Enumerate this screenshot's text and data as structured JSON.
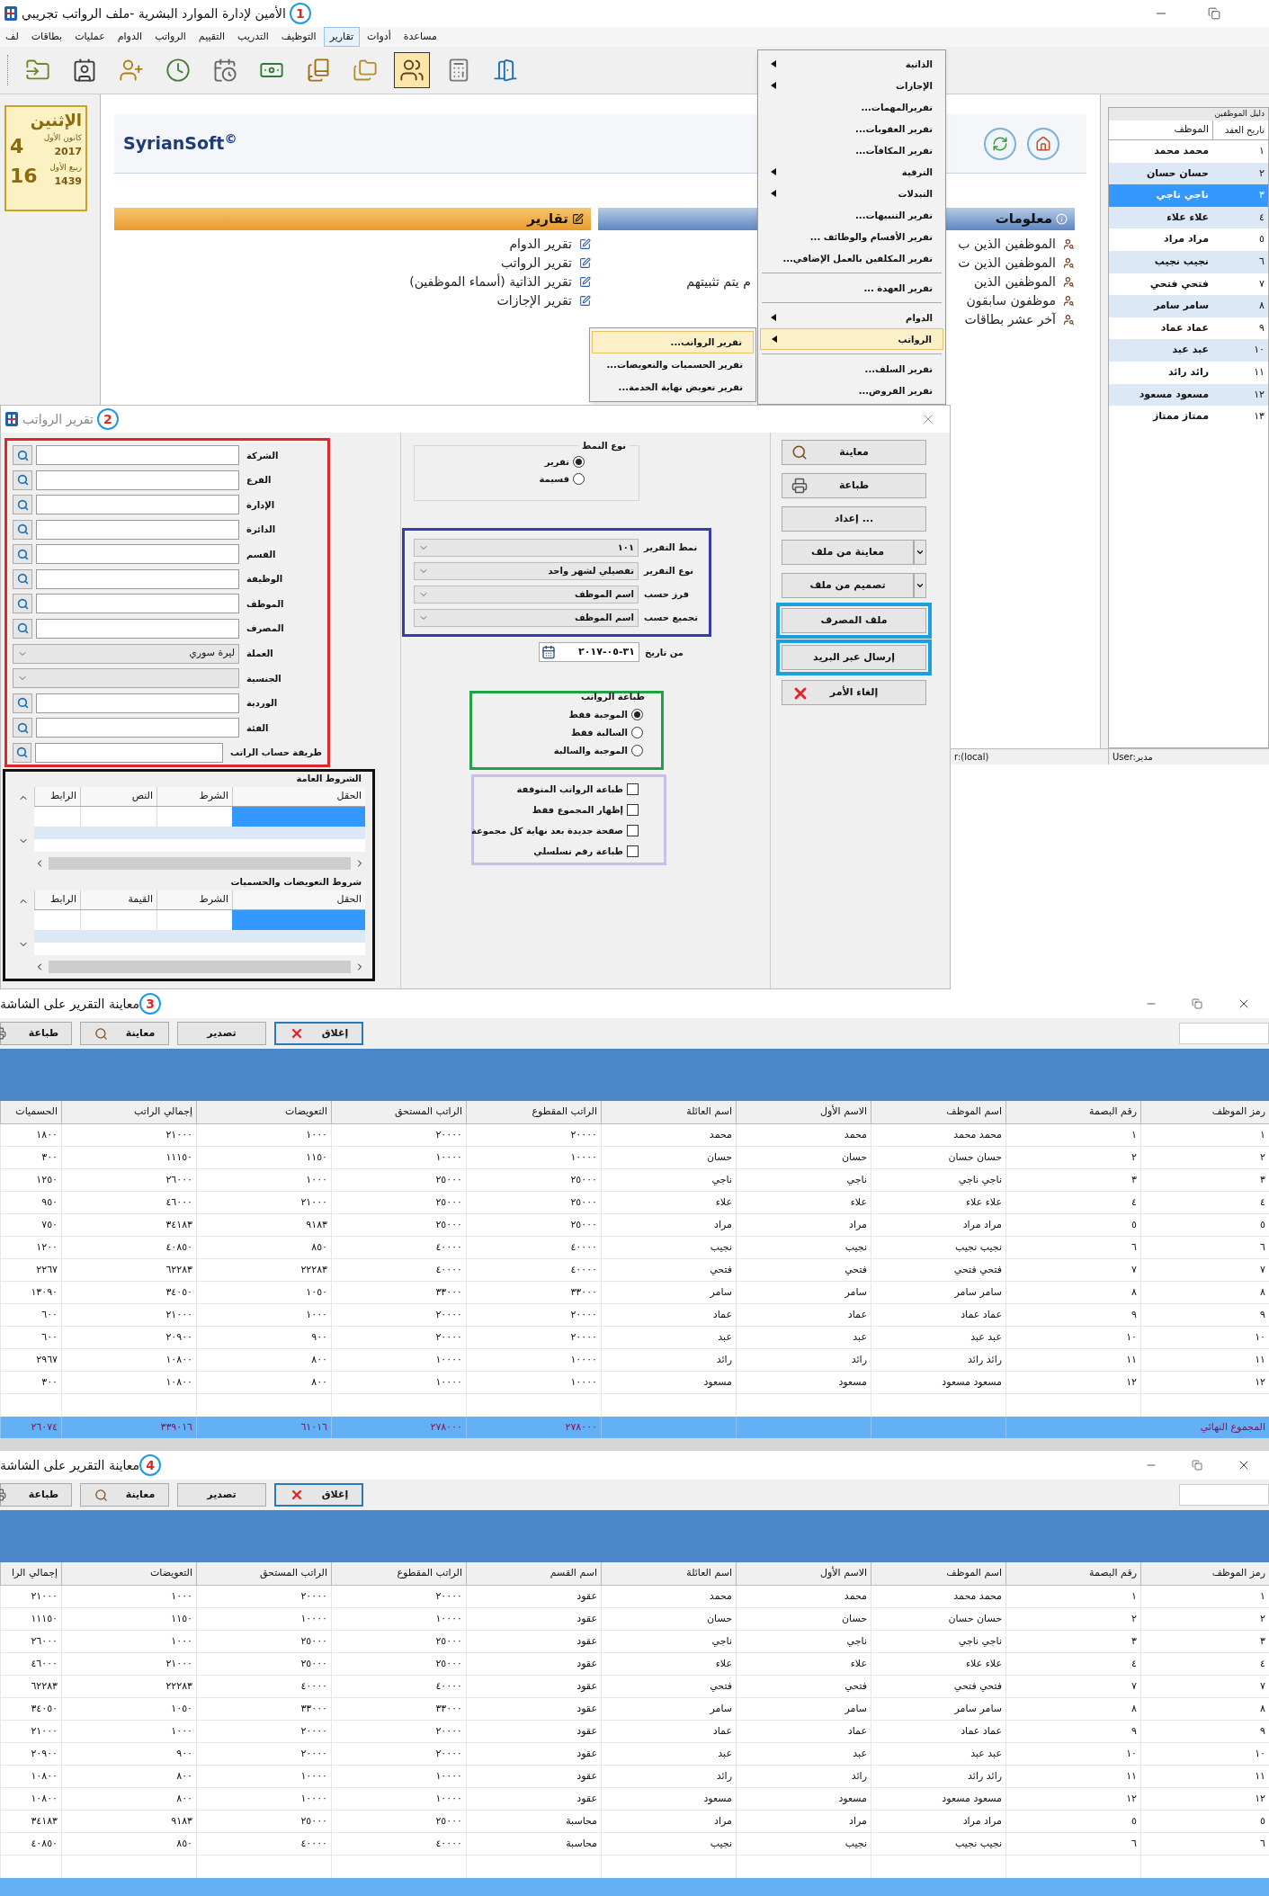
{
  "main_window": {
    "title": "الأمين لإدارة الموارد البشرية -ملف الرواتب تجريبي",
    "badge": "1",
    "menu": [
      {
        "label": "مساعدة",
        "selected": false
      },
      {
        "label": "أدوات",
        "selected": false
      },
      {
        "label": "تقارير",
        "selected": true
      },
      {
        "label": "التوظيف",
        "selected": false
      },
      {
        "label": "التدريب",
        "selected": false
      },
      {
        "label": "التقييم",
        "selected": false
      },
      {
        "label": "الرواتب",
        "selected": false
      },
      {
        "label": "الدوام",
        "selected": false
      },
      {
        "label": "عمليات",
        "selected": false
      },
      {
        "label": "بطاقات",
        "selected": false
      },
      {
        "label": "لف",
        "selected": false
      }
    ],
    "toolbar": [
      {
        "selected": false
      },
      {
        "selected": false
      },
      {
        "selected": false
      },
      {
        "selected": false
      },
      {
        "selected": false
      },
      {
        "selected": false
      },
      {
        "selected": false
      },
      {
        "selected": false
      },
      {
        "selected": true
      },
      {
        "selected": false
      },
      {
        "selected": false
      }
    ],
    "date_widget": {
      "weekday": "الإثنين",
      "gregorian_day": "4",
      "gregorian_month": "كانون الأول",
      "gregorian_year": "2017",
      "hijri_day": "16",
      "hijri_month": "ربيع الأول",
      "hijri_year": "1439"
    },
    "logo": "SyrianSoft$^{©}$",
    "reports_panel": {
      "title": "تقارير",
      "items": [
        "تقرير الدوام",
        "تقرير الرواتب",
        "تقرير الذاتية (أسماء الموظفين)",
        "تقرير الإجازات"
      ]
    },
    "info_panel": {
      "title": "معلومات",
      "items": [
        {
          "text": "الموظفين الذين ب"
        },
        {
          "text": "الموظفين الذين ت"
        },
        {
          "text": "الموظفين الذين",
          "continuation": "م يتم تثبيتهم"
        },
        {
          "text": "موظفون سابقون"
        },
        {
          "text": "آخر عشر بطاقات"
        }
      ]
    },
    "reports_menu": [
      {
        "label": "الذاتية",
        "kind": "submenu",
        "selected": false,
        "divider_after": false
      },
      {
        "label": "الإجازات",
        "kind": "submenu",
        "selected": false,
        "divider_after": false
      },
      {
        "label": "تقريرالمهمات...",
        "kind": "command",
        "selected": false,
        "divider_after": false
      },
      {
        "label": "تقرير العقوبات...",
        "kind": "command",
        "selected": false,
        "divider_after": false
      },
      {
        "label": "تقرير المكافآت...",
        "kind": "command",
        "selected": false,
        "divider_after": false
      },
      {
        "label": "الترقية",
        "kind": "submenu",
        "selected": false,
        "divider_after": false
      },
      {
        "label": "التبدلات",
        "kind": "submenu",
        "selected": false,
        "divider_after": false
      },
      {
        "label": "تقرير التنبيهات...",
        "kind": "command",
        "selected": false,
        "divider_after": false
      },
      {
        "label": "تقرير الأقسام والوظائف ...",
        "kind": "command",
        "selected": false,
        "divider_after": false
      },
      {
        "label": "تقرير المكلفين بالعمل الإضافي...",
        "kind": "command",
        "selected": false,
        "divider_after": true
      },
      {
        "label": "تقرير العهدة ...",
        "kind": "command",
        "selected": false,
        "divider_after": true
      },
      {
        "label": "الدوام",
        "kind": "submenu",
        "selected": false,
        "divider_after": false
      },
      {
        "label": "الرواتب",
        "kind": "submenu",
        "selected": true,
        "divider_after": true
      },
      {
        "label": "تقرير السلف...",
        "kind": "command",
        "selected": false,
        "divider_after": false
      },
      {
        "label": "تقرير القروض...",
        "kind": "command",
        "selected": false,
        "divider_after": false
      }
    ],
    "salaries_submenu": [
      {
        "label": "تقرير الرواتب...",
        "selected": true
      },
      {
        "label": "تقرير الحسميات والتعويضات...",
        "selected": false
      },
      {
        "label": "تقرير تعويض نهاية الخدمة...",
        "selected": false
      }
    ],
    "employee_directory": {
      "title": "دليل الموظفين",
      "columns": [
        "تاريخ العقد",
        "الموظف"
      ],
      "rows": [
        {
          "number": "١",
          "name": "محمد محمد",
          "selected": false
        },
        {
          "number": "٢",
          "name": "حسان حسان",
          "selected": false
        },
        {
          "number": "٣",
          "name": "ناجي ناجي",
          "selected": true
        },
        {
          "number": "٤",
          "name": "علاء علاء",
          "selected": false
        },
        {
          "number": "٥",
          "name": "مراد مراد",
          "selected": false
        },
        {
          "number": "٦",
          "name": "نجيب نجيب",
          "selected": false
        },
        {
          "number": "٧",
          "name": "فتحي فتحي",
          "selected": false
        },
        {
          "number": "٨",
          "name": "سامر سامر",
          "selected": false
        },
        {
          "number": "٩",
          "name": "عماد عماد",
          "selected": false
        },
        {
          "number": "١٠",
          "name": "عبد عبد",
          "selected": false
        },
        {
          "number": "١١",
          "name": "رائد رائد",
          "selected": false
        },
        {
          "number": "١٢",
          "name": "مسعود مسعود",
          "selected": false
        },
        {
          "number": "١٣",
          "name": "ممتاز ممتاز",
          "selected": false
        }
      ]
    },
    "status_bar": [
      "User:مدير",
      "r:(local)"
    ]
  },
  "salary_report_dialog": {
    "title": "تقرير الرواتب",
    "badge": "2",
    "filters": [
      {
        "label": "الشركة",
        "kind": "lookup"
      },
      {
        "label": "الفرع",
        "kind": "lookup"
      },
      {
        "label": "الإدارة",
        "kind": "lookup"
      },
      {
        "label": "الدائرة",
        "kind": "lookup"
      },
      {
        "label": "القسم",
        "kind": "lookup"
      },
      {
        "label": "الوظيفة",
        "kind": "lookup"
      },
      {
        "label": "الموظف",
        "kind": "lookup"
      },
      {
        "label": "المصرف",
        "kind": "lookup"
      },
      {
        "label": "العملة",
        "kind": "dropdown",
        "value": "ليرة سوري"
      },
      {
        "label": "الجنسية",
        "kind": "dropdown"
      },
      {
        "label": "الوردية",
        "kind": "lookup"
      },
      {
        "label": "الفئة",
        "kind": "lookup"
      },
      {
        "label": "طريقة حساب الراتب",
        "kind": "lookup"
      }
    ],
    "condition_grids": [
      {
        "title": "الشروط العامة",
        "columns": [
          "الحقل",
          "الشرط",
          "النص",
          "الرابط"
        ]
      },
      {
        "title": "شروط التعويضات والحسميات",
        "columns": [
          "الحقل",
          "الشرط",
          "القيمة",
          "الرابط"
        ]
      }
    ],
    "layout_type": {
      "title": "نوع النمط",
      "options": [
        {
          "label": "تقرير",
          "selected": true
        },
        {
          "label": "قسيمة",
          "selected": false
        }
      ]
    },
    "report_settings": [
      {
        "label": "نمط التقرير",
        "value": "١٠١"
      },
      {
        "label": "نوع التقرير",
        "value": "تفصيلي لشهر واحد"
      },
      {
        "label": "فرز حسب",
        "value": "اسم الموظف"
      },
      {
        "label": "تجميع حسب",
        "value": "اسم الموظف"
      }
    ],
    "date": {
      "label": "من تاريخ",
      "value": "٣١-٠٥-٢٠١٧"
    },
    "salary_printing": {
      "title": "طباعة الرواتب",
      "options": [
        {
          "label": "الموجبة فقط",
          "selected": true
        },
        {
          "label": "السالبة فقط",
          "selected": false
        },
        {
          "label": "الموجبة والسالبة",
          "selected": false
        }
      ]
    },
    "options": [
      {
        "label": "طباعة الرواتب المتوقفة",
        "checked": false
      },
      {
        "label": "إظهار المجموع فقط",
        "checked": false
      },
      {
        "label": "صفحة جديدة بعد نهاية كل مجموعة",
        "checked": false
      },
      {
        "label": "طباعة رقم تسلسلي",
        "checked": false
      }
    ],
    "buttons": [
      {
        "label": "معاينة",
        "kind": "preview"
      },
      {
        "label": "طباعة",
        "kind": "print"
      },
      {
        "label": "إعداد ...",
        "kind": "plain"
      },
      {
        "label": "معاينة من ملف",
        "kind": "split"
      },
      {
        "label": "تصميم من ملف",
        "kind": "split"
      },
      {
        "label": "ملف المصرف",
        "kind": "plain"
      },
      {
        "label": "إرسال عبر البريد",
        "kind": "plain"
      },
      {
        "label": "إلغاء الأمر",
        "kind": "cancel"
      }
    ]
  },
  "previews": [
    {
      "title": "معاينة التقرير على الشاشة",
      "badge": "3",
      "toolbar": [
        {
          "label": "إغلاق",
          "kind": "close"
        },
        {
          "label": "تصدير",
          "kind": "plain"
        },
        {
          "label": "معاينة",
          "kind": "preview"
        },
        {
          "label": "طباعة",
          "kind": "print"
        }
      ],
      "columns": [
        "رمز الموظف",
        "رقم البصمة",
        "اسم الموظف",
        "الاسم الأول",
        "اسم العائلة",
        "الراتب المقطوع",
        "الراتب المستحق",
        "التعويضات",
        "إجمالي الراتب",
        "الحسميات"
      ],
      "rows": [
        [
          "١",
          "١",
          "محمد محمد",
          "محمد",
          "محمد",
          "٢٠٠٠٠",
          "٢٠٠٠٠",
          "١٠٠٠",
          "٢١٠٠٠",
          "١٨٠٠"
        ],
        [
          "٢",
          "٢",
          "حسان حسان",
          "حسان",
          "حسان",
          "١٠٠٠٠",
          "١٠٠٠٠",
          "١١٥٠",
          "١١١٥٠",
          "٣٠٠"
        ],
        [
          "٣",
          "٣",
          "ناجي ناجي",
          "ناجي",
          "ناجي",
          "٢٥٠٠٠",
          "٢٥٠٠٠",
          "١٠٠٠",
          "٢٦٠٠٠",
          "١٢٥٠"
        ],
        [
          "٤",
          "٤",
          "علاء علاء",
          "علاء",
          "علاء",
          "٢٥٠٠٠",
          "٢٥٠٠٠",
          "٢١٠٠٠",
          "٤٦٠٠٠",
          "٩٥٠"
        ],
        [
          "٥",
          "٥",
          "مراد مراد",
          "مراد",
          "مراد",
          "٢٥٠٠٠",
          "٢٥٠٠٠",
          "٩١٨٣",
          "٣٤١٨٣",
          "٧٥٠"
        ],
        [
          "٦",
          "٦",
          "نجيب نجيب",
          "نجيب",
          "نجيب",
          "٤٠٠٠٠",
          "٤٠٠٠٠",
          "٨٥٠",
          "٤٠٨٥٠",
          "١٢٠٠"
        ],
        [
          "٧",
          "٧",
          "فتحي فتحي",
          "فتحي",
          "فتحي",
          "٤٠٠٠٠",
          "٤٠٠٠٠",
          "٢٢٢٨٣",
          "٦٢٢٨٣",
          "٢٢٦٧"
        ],
        [
          "٨",
          "٨",
          "سامر سامر",
          "سامر",
          "سامر",
          "٣٣٠٠٠",
          "٣٣٠٠٠",
          "١٠٥٠",
          "٣٤٠٥٠",
          "١٣٠٩٠"
        ],
        [
          "٩",
          "٩",
          "عماد عماد",
          "عماد",
          "عماد",
          "٢٠٠٠٠",
          "٢٠٠٠٠",
          "١٠٠٠",
          "٢١٠٠٠",
          "٦٠٠"
        ],
        [
          "١٠",
          "١٠",
          "عبد عبد",
          "عبد",
          "عبد",
          "٢٠٠٠٠",
          "٢٠٠٠٠",
          "٩٠٠",
          "٢٠٩٠٠",
          "٦٠٠"
        ],
        [
          "١١",
          "١١",
          "رائد رائد",
          "رائد",
          "رائد",
          "١٠٠٠٠",
          "١٠٠٠٠",
          "٨٠٠",
          "١٠٨٠٠",
          "٢٩٦٧"
        ],
        [
          "١٢",
          "١٢",
          "مسعود مسعود",
          "مسعود",
          "مسعود",
          "١٠٠٠٠",
          "١٠٠٠٠",
          "٨٠٠",
          "١٠٨٠٠",
          "٣٠٠"
        ]
      ],
      "total": {
        "label": "المجموع النهائي",
        "values": [
          "٢٧٨٠٠٠",
          "٢٧٨٠٠٠",
          "٦١٠١٦",
          "٣٣٩٠١٦",
          "٢٦٠٧٤"
        ]
      }
    },
    {
      "title": "معاينة التقرير على الشاشة",
      "badge": "4",
      "toolbar": [
        {
          "label": "إغلاق",
          "kind": "close"
        },
        {
          "label": "تصدير",
          "kind": "plain"
        },
        {
          "label": "معاينة",
          "kind": "preview"
        },
        {
          "label": "طباعة",
          "kind": "print"
        }
      ],
      "columns": [
        "رمز الموظف",
        "رقم البصمة",
        "اسم الموظف",
        "الاسم الأول",
        "اسم العائلة",
        "اسم القسم",
        "الراتب المقطوع",
        "الراتب المستحق",
        "التعويضات",
        "إجمالي الرا"
      ],
      "rows": [
        [
          "١",
          "١",
          "محمد محمد",
          "محمد",
          "محمد",
          "عقود",
          "٢٠٠٠٠",
          "٢٠٠٠٠",
          "١٠٠٠",
          "٢١٠٠٠"
        ],
        [
          "٢",
          "٢",
          "حسان حسان",
          "حسان",
          "حسان",
          "عقود",
          "١٠٠٠٠",
          "١٠٠٠٠",
          "١١٥٠",
          "١١١٥٠"
        ],
        [
          "٣",
          "٣",
          "ناجي ناجي",
          "ناجي",
          "ناجي",
          "عقود",
          "٢٥٠٠٠",
          "٢٥٠٠٠",
          "١٠٠٠",
          "٢٦٠٠٠"
        ],
        [
          "٤",
          "٤",
          "علاء علاء",
          "علاء",
          "علاء",
          "عقود",
          "٢٥٠٠٠",
          "٢٥٠٠٠",
          "٢١٠٠٠",
          "٤٦٠٠٠"
        ],
        [
          "٧",
          "٧",
          "فتحي فتحي",
          "فتحي",
          "فتحي",
          "عقود",
          "٤٠٠٠٠",
          "٤٠٠٠٠",
          "٢٢٢٨٣",
          "٦٢٢٨٣"
        ],
        [
          "٨",
          "٨",
          "سامر سامر",
          "سامر",
          "سامر",
          "عقود",
          "٣٣٠٠٠",
          "٣٣٠٠٠",
          "١٠٥٠",
          "٣٤٠٥٠"
        ],
        [
          "٩",
          "٩",
          "عماد عماد",
          "عماد",
          "عماد",
          "عقود",
          "٢٠٠٠٠",
          "٢٠٠٠٠",
          "١٠٠٠",
          "٢١٠٠٠"
        ],
        [
          "١٠",
          "١٠",
          "عبد عبد",
          "عبد",
          "عبد",
          "عقود",
          "٢٠٠٠٠",
          "٢٠٠٠٠",
          "٩٠٠",
          "٢٠٩٠٠"
        ],
        [
          "١١",
          "١١",
          "رائد رائد",
          "رائد",
          "رائد",
          "عقود",
          "١٠٠٠٠",
          "١٠٠٠٠",
          "٨٠٠",
          "١٠٨٠٠"
        ],
        [
          "١٢",
          "١٢",
          "مسعود مسعود",
          "مسعود",
          "مسعود",
          "عقود",
          "١٠٠٠٠",
          "١٠٠٠٠",
          "٨٠٠",
          "١٠٨٠٠"
        ],
        [
          "٥",
          "٥",
          "مراد مراد",
          "مراد",
          "مراد",
          "محاسبة",
          "٢٥٠٠٠",
          "٢٥٠٠٠",
          "٩١٨٣",
          "٣٤١٨٣"
        ],
        [
          "٦",
          "٦",
          "نجيب نجيب",
          "نجيب",
          "نجيب",
          "محاسبة",
          "٤٠٠٠٠",
          "٤٠٠٠٠",
          "٨٥٠",
          "٤٠٨٥٠"
        ]
      ]
    }
  ]
}
